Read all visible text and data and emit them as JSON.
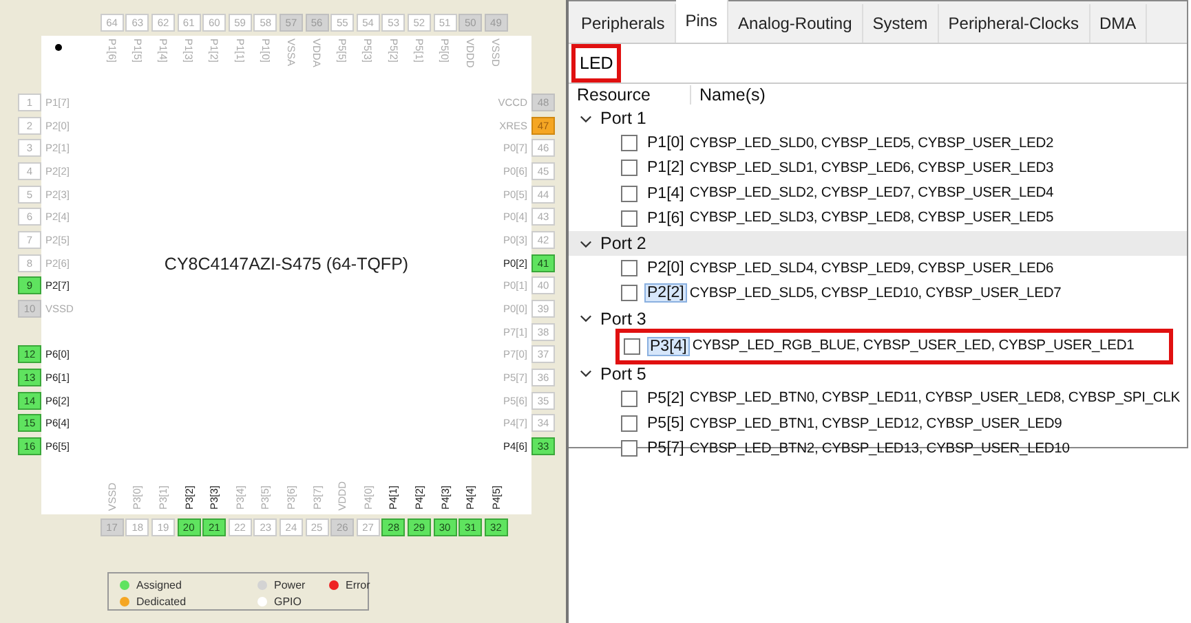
{
  "chip": {
    "name": "CY8C4147AZI-S475 (64-TQFP)",
    "top_pins": [
      {
        "number": "64",
        "label": "P1[6]",
        "kind": "gpio"
      },
      {
        "number": "63",
        "label": "P1[5]",
        "kind": "gpio"
      },
      {
        "number": "62",
        "label": "P1[4]",
        "kind": "gpio"
      },
      {
        "number": "61",
        "label": "P1[3]",
        "kind": "gpio"
      },
      {
        "number": "60",
        "label": "P1[2]",
        "kind": "gpio"
      },
      {
        "number": "59",
        "label": "P1[1]",
        "kind": "gpio"
      },
      {
        "number": "58",
        "label": "P1[0]",
        "kind": "gpio"
      },
      {
        "number": "57",
        "label": "VSSA",
        "kind": "power"
      },
      {
        "number": "56",
        "label": "VDDA",
        "kind": "power"
      },
      {
        "number": "55",
        "label": "P5[5]",
        "kind": "gpio"
      },
      {
        "number": "54",
        "label": "P5[3]",
        "kind": "gpio"
      },
      {
        "number": "53",
        "label": "P5[2]",
        "kind": "gpio"
      },
      {
        "number": "52",
        "label": "P5[1]",
        "kind": "gpio"
      },
      {
        "number": "51",
        "label": "P5[0]",
        "kind": "gpio"
      },
      {
        "number": "50",
        "label": "VDDD",
        "kind": "power"
      },
      {
        "number": "49",
        "label": "VSSD",
        "kind": "power"
      }
    ],
    "left_pin_groups": [
      [
        {
          "number": "1",
          "label": "P1[7]",
          "kind": "gpio"
        },
        {
          "number": "2",
          "label": "P2[0]",
          "kind": "gpio"
        },
        {
          "number": "3",
          "label": "P2[1]",
          "kind": "gpio"
        },
        {
          "number": "4",
          "label": "P2[2]",
          "kind": "gpio"
        },
        {
          "number": "5",
          "label": "P2[3]",
          "kind": "gpio"
        },
        {
          "number": "6",
          "label": "P2[4]",
          "kind": "gpio"
        },
        {
          "number": "7",
          "label": "P2[5]",
          "kind": "gpio"
        },
        {
          "number": "8",
          "label": "P2[6]",
          "kind": "gpio"
        },
        {
          "number": "9",
          "label": "P2[7]",
          "kind": "assigned"
        },
        {
          "number": "10",
          "label": "VSSD",
          "kind": "power"
        }
      ],
      [
        {
          "number": "12",
          "label": "P6[0]",
          "kind": "assigned"
        },
        {
          "number": "13",
          "label": "P6[1]",
          "kind": "assigned"
        },
        {
          "number": "14",
          "label": "P6[2]",
          "kind": "assigned"
        },
        {
          "number": "15",
          "label": "P6[4]",
          "kind": "assigned"
        },
        {
          "number": "16",
          "label": "P6[5]",
          "kind": "assigned"
        }
      ]
    ],
    "right_pins": [
      {
        "number": "48",
        "label": "VCCD",
        "kind": "power"
      },
      {
        "number": "47",
        "label": "XRES",
        "kind": "dedicated"
      },
      {
        "number": "46",
        "label": "P0[7]",
        "kind": "gpio"
      },
      {
        "number": "45",
        "label": "P0[6]",
        "kind": "gpio"
      },
      {
        "number": "44",
        "label": "P0[5]",
        "kind": "gpio"
      },
      {
        "number": "43",
        "label": "P0[4]",
        "kind": "gpio"
      },
      {
        "number": "42",
        "label": "P0[3]",
        "kind": "gpio"
      },
      {
        "number": "41",
        "label": "P0[2]",
        "kind": "assigned"
      },
      {
        "number": "40",
        "label": "P0[1]",
        "kind": "gpio"
      },
      {
        "number": "39",
        "label": "P0[0]",
        "kind": "gpio"
      },
      {
        "number": "38",
        "label": "P7[1]",
        "kind": "gpio"
      },
      {
        "number": "37",
        "label": "P7[0]",
        "kind": "gpio"
      },
      {
        "number": "36",
        "label": "P5[7]",
        "kind": "gpio"
      },
      {
        "number": "35",
        "label": "P5[6]",
        "kind": "gpio"
      },
      {
        "number": "34",
        "label": "P4[7]",
        "kind": "gpio"
      },
      {
        "number": "33",
        "label": "P4[6]",
        "kind": "assigned"
      }
    ],
    "bottom_pins": [
      {
        "number": "17",
        "label": "VSSD",
        "kind": "power"
      },
      {
        "number": "18",
        "label": "P3[0]",
        "kind": "gpio"
      },
      {
        "number": "19",
        "label": "P3[1]",
        "kind": "gpio"
      },
      {
        "number": "20",
        "label": "P3[2]",
        "kind": "assigned"
      },
      {
        "number": "21",
        "label": "P3[3]",
        "kind": "assigned"
      },
      {
        "number": "22",
        "label": "P3[4]",
        "kind": "gpio"
      },
      {
        "number": "23",
        "label": "P3[5]",
        "kind": "gpio"
      },
      {
        "number": "24",
        "label": "P3[6]",
        "kind": "gpio"
      },
      {
        "number": "25",
        "label": "P3[7]",
        "kind": "gpio"
      },
      {
        "number": "26",
        "label": "VDDD",
        "kind": "power"
      },
      {
        "number": "27",
        "label": "P4[0]",
        "kind": "gpio"
      },
      {
        "number": "28",
        "label": "P4[1]",
        "kind": "assigned"
      },
      {
        "number": "29",
        "label": "P4[2]",
        "kind": "assigned"
      },
      {
        "number": "30",
        "label": "P4[3]",
        "kind": "assigned"
      },
      {
        "number": "31",
        "label": "P4[4]",
        "kind": "assigned"
      },
      {
        "number": "32",
        "label": "P4[5]",
        "kind": "assigned"
      }
    ]
  },
  "legend": [
    {
      "label": "Assigned",
      "color": "#5fe35f"
    },
    {
      "label": "Power",
      "color": "#d3d3d3"
    },
    {
      "label": "Error",
      "color": "#ee2222"
    },
    {
      "label": "Dedicated",
      "color": "#f5a623"
    },
    {
      "label": "GPIO",
      "color": "#ffffff"
    }
  ],
  "tabs": [
    {
      "label": "Peripherals",
      "selected": false
    },
    {
      "label": "Pins",
      "selected": true
    },
    {
      "label": "Analog-Routing",
      "selected": false
    },
    {
      "label": "System",
      "selected": false
    },
    {
      "label": "Peripheral-Clocks",
      "selected": false
    },
    {
      "label": "DMA",
      "selected": false
    }
  ],
  "filter": {
    "value": "LED",
    "annotated": true
  },
  "columns": [
    "Resource",
    "Name(s)"
  ],
  "ports": [
    {
      "label": "Port 1",
      "expanded": true,
      "selected": false,
      "children": [
        {
          "resource": "P1[0]",
          "names": "CYBSP_LED_SLD0, CYBSP_LED5, CYBSP_USER_LED2",
          "checked": false,
          "focused": false,
          "annotated": false
        },
        {
          "resource": "P1[2]",
          "names": "CYBSP_LED_SLD1, CYBSP_LED6, CYBSP_USER_LED3",
          "checked": false,
          "focused": false,
          "annotated": false
        },
        {
          "resource": "P1[4]",
          "names": "CYBSP_LED_SLD2, CYBSP_LED7, CYBSP_USER_LED4",
          "checked": false,
          "focused": false,
          "annotated": false
        },
        {
          "resource": "P1[6]",
          "names": "CYBSP_LED_SLD3, CYBSP_LED8, CYBSP_USER_LED5",
          "checked": false,
          "focused": false,
          "annotated": false
        }
      ]
    },
    {
      "label": "Port 2",
      "expanded": true,
      "selected": true,
      "children": [
        {
          "resource": "P2[0]",
          "names": "CYBSP_LED_SLD4, CYBSP_LED9, CYBSP_USER_LED6",
          "checked": false,
          "focused": false,
          "annotated": false
        },
        {
          "resource": "P2[2]",
          "names": "CYBSP_LED_SLD5, CYBSP_LED10, CYBSP_USER_LED7",
          "checked": false,
          "focused": true,
          "annotated": false
        }
      ]
    },
    {
      "label": "Port 3",
      "expanded": true,
      "selected": false,
      "children": [
        {
          "resource": "P3[4]",
          "names": "CYBSP_LED_RGB_BLUE, CYBSP_USER_LED, CYBSP_USER_LED1",
          "checked": false,
          "focused": true,
          "annotated": true
        }
      ]
    },
    {
      "label": "Port 5",
      "expanded": true,
      "selected": false,
      "children": [
        {
          "resource": "P5[2]",
          "names": "CYBSP_LED_BTN0, CYBSP_LED11, CYBSP_USER_LED8, CYBSP_SPI_CLK",
          "checked": false,
          "focused": false,
          "annotated": false
        },
        {
          "resource": "P5[5]",
          "names": "CYBSP_LED_BTN1, CYBSP_LED12, CYBSP_USER_LED9",
          "checked": false,
          "focused": false,
          "annotated": false
        },
        {
          "resource": "P5[7]",
          "names": "CYBSP_LED_BTN2, CYBSP_LED13, CYBSP_USER_LED10",
          "checked": false,
          "focused": false,
          "annotated": false
        }
      ]
    }
  ]
}
